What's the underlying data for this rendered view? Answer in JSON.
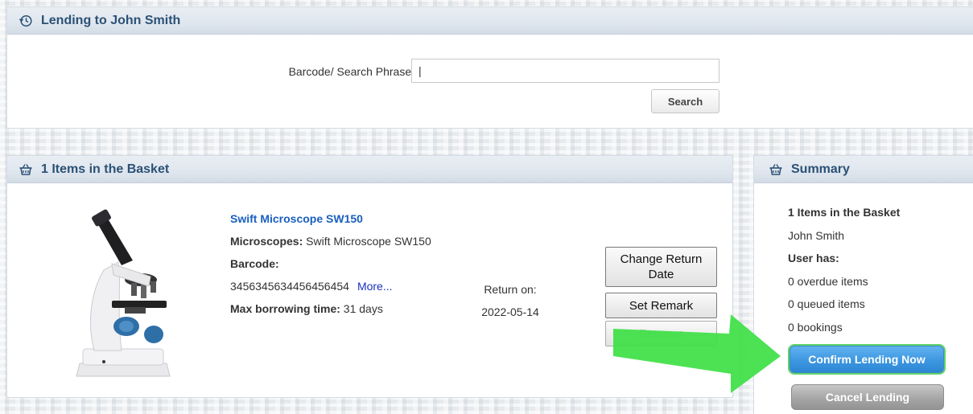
{
  "lending_panel": {
    "title": "Lending to John Smith",
    "icon": "history-icon",
    "search_label": "Barcode/ Search Phrase:",
    "search_value": "|",
    "search_button": "Search"
  },
  "basket": {
    "title": "1 Items in the Basket",
    "icon": "basket-icon",
    "item": {
      "image": "microscope-image",
      "name": "Swift Microscope SW150",
      "category_label": "Microscopes:",
      "category_value": "Swift Microscope SW150",
      "barcode_label": "Barcode:",
      "barcode_value": "3456345634456456454",
      "more_link": "More...",
      "max_borrow_label": "Max borrowing time:",
      "max_borrow_value": "31 days",
      "return_label": "Return on:",
      "return_date": "2022-05-14"
    },
    "actions": {
      "change_return_date": "Change Return Date",
      "set_remark": "Set Remark",
      "remove": "Remove"
    }
  },
  "summary": {
    "title": "Summary",
    "icon": "basket-icon",
    "items_in_basket": "1 Items in the Basket",
    "user_name": "John Smith",
    "user_has_label": "User has:",
    "overdue": "0 overdue items",
    "queued": "0 queued items",
    "bookings": "0 bookings",
    "confirm_button": "Confirm Lending Now",
    "cancel_button": "Cancel Lending"
  },
  "annotation": {
    "arrow_icon": "green-arrow",
    "arrow_color": "#3fe047"
  }
}
